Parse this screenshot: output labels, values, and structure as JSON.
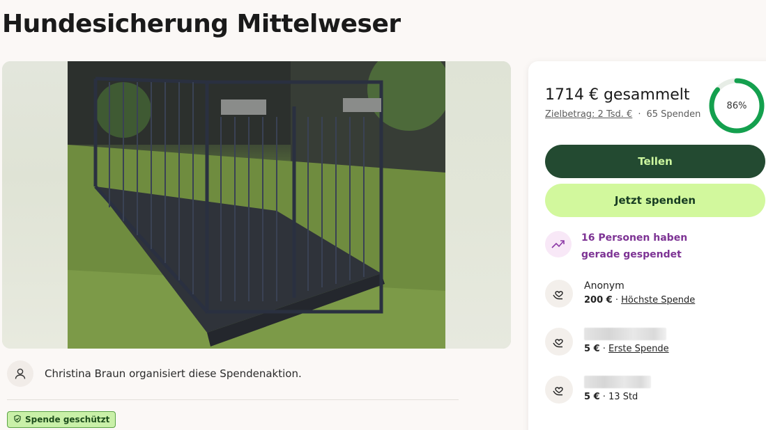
{
  "page": {
    "title": "Hundesicherung Mittelweser"
  },
  "organizer": {
    "text": "Christina Braun organisiert diese Spendenaktion."
  },
  "badge": {
    "label": "Spende geschützt"
  },
  "stats": {
    "raised": "1714 € gesammelt",
    "goal": "Zielbetrag: 2 Tsd. €",
    "separator": "·",
    "donations": "65 Spenden",
    "percent_label": "86%",
    "percent_value": 0.86,
    "ring_color": "#14a04e"
  },
  "buttons": {
    "share": "Tellen",
    "donate": "Jetzt spenden"
  },
  "trend": {
    "text": "16 Personen haben gerade gespendet"
  },
  "donors": [
    {
      "name": "Anonym",
      "amount": "200 €",
      "sep": " · ",
      "note": "Höchste Spende",
      "note_underlined": true
    },
    {
      "name": "",
      "amount": "5 €",
      "sep": " · ",
      "note": "Erste Spende",
      "note_underlined": true
    },
    {
      "name": "",
      "amount": "5 €",
      "sep": " · ",
      "note": "13 Std",
      "note_underlined": false
    }
  ]
}
